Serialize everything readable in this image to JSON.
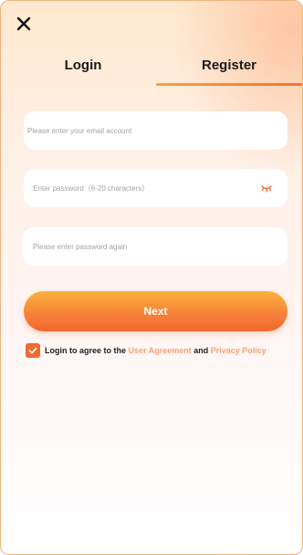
{
  "header": {
    "close_icon": "close-icon"
  },
  "tabs": [
    {
      "label": "Login",
      "active": false
    },
    {
      "label": "Register",
      "active": true
    }
  ],
  "form": {
    "email_placeholder": "Please enter your email account",
    "email_value": "",
    "password_placeholder": ":Enter password（6-20 characters）",
    "password_value": "",
    "password_toggle_icon": "eye-closed-icon",
    "confirm_placeholder": "Please enter password again",
    "confirm_value": "",
    "next_label": "Next"
  },
  "agreement": {
    "checked": true,
    "prefix": "Login to agree to the",
    "user_agreement": "User Agreement",
    "conjunction": "and",
    "privacy_policy": "Privacy Policy"
  },
  "colors": {
    "accent": "#f06a2e",
    "button_top": "#fbb13a",
    "button_bottom": "#f1662d",
    "link": "#f9a072",
    "border": "#efb47d"
  }
}
